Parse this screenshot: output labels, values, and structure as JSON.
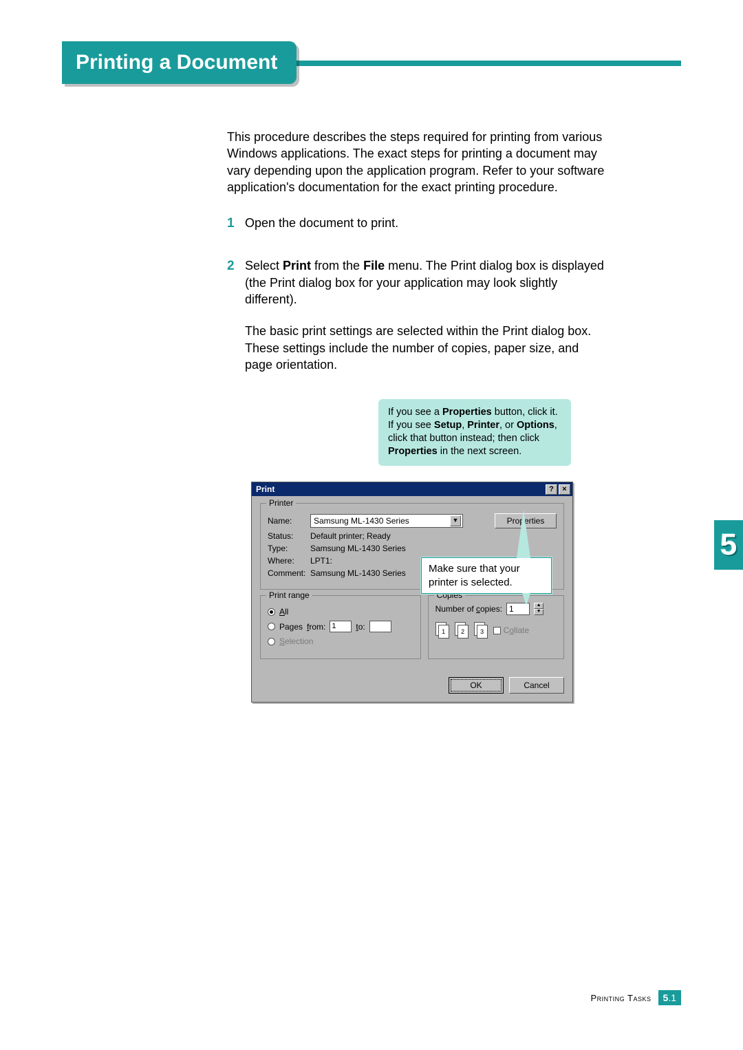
{
  "title": "Printing a Document",
  "intro": "This procedure describes the steps required for printing from various Windows applications. The exact steps for printing a document may vary depending upon the application program. Refer to your software application's documentation for the exact printing procedure.",
  "steps": {
    "s1": {
      "num": "1",
      "text": "Open the document to print."
    },
    "s2": {
      "num": "2",
      "text_before": "Select ",
      "bold1": "Print",
      "text_mid1": " from the ",
      "bold2": "File",
      "text_after": " menu. The Print dialog box is displayed (the Print dialog box for your application may look slightly different).",
      "para2": "The basic print settings are selected within the Print dialog box. These settings include the number of copies, paper size, and page orientation."
    }
  },
  "callout_prop": {
    "t1": "If you see a ",
    "b1": "Properties",
    "t2": " button, click it. If you see ",
    "b2": "Setup",
    "t3": ", ",
    "b3": "Printer",
    "t4": ", or ",
    "b4": "Options",
    "t5": ", click that button instead; then click ",
    "b5": "Properties",
    "t6": " in the next screen."
  },
  "callout_sel": "Make sure that your printer is selected.",
  "dialog": {
    "title": "Print",
    "help": "?",
    "close": "×",
    "printer": {
      "legend": "Printer",
      "name_label": "Name:",
      "name_value": "Samsung ML-1430 Series",
      "props_btn": "Properties",
      "status_label": "Status:",
      "status_value": "Default printer; Ready",
      "type_label": "Type:",
      "type_value": "Samsung ML-1430 Series",
      "where_label": "Where:",
      "where_value": "LPT1:",
      "comment_label": "Comment:",
      "comment_value": "Samsung ML-1430 Series"
    },
    "range": {
      "legend": "Print range",
      "all": "All",
      "pages": "Pages",
      "from_label": "from:",
      "from_value": "1",
      "to_label": "to:",
      "to_value": "",
      "selection": "Selection"
    },
    "copies": {
      "legend": "Copies",
      "num_label": "Number of copies:",
      "num_value": "1",
      "p1": "1",
      "p2": "2",
      "p3": "3",
      "collate": "Collate"
    },
    "ok": "OK",
    "cancel": "Cancel"
  },
  "chapter_tab": "5",
  "footer": {
    "label": "Printing Tasks",
    "major": "5",
    "minor": ".1"
  }
}
